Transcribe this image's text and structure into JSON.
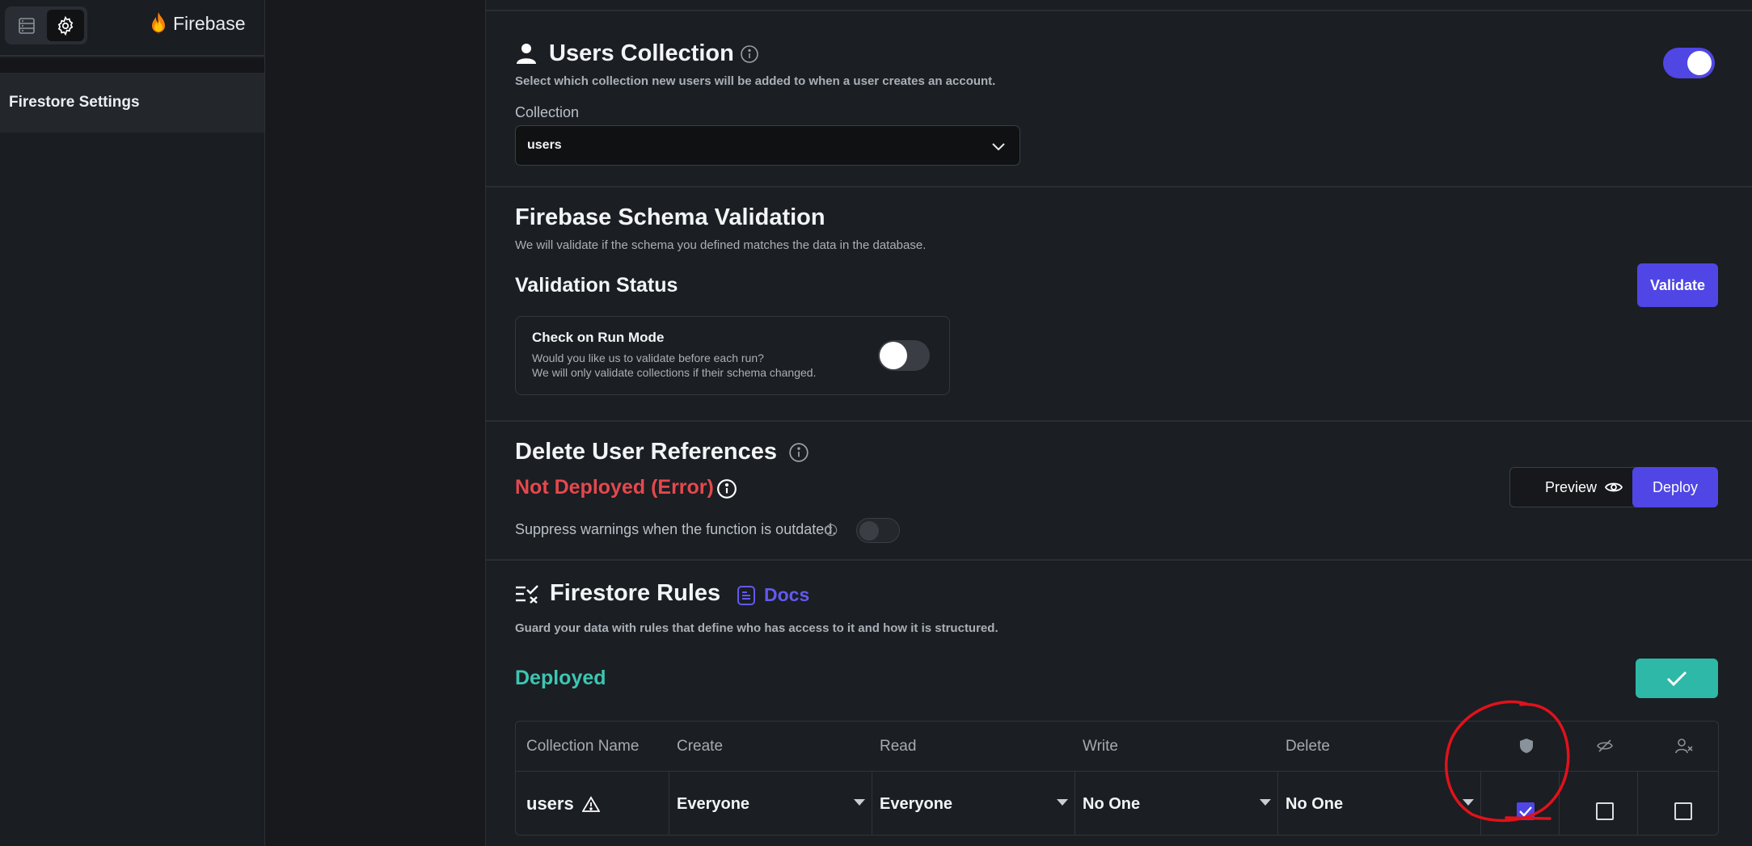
{
  "sidebar": {
    "brand": "Firebase",
    "nav_item": "Firestore Settings"
  },
  "users_collection": {
    "title": "Users Collection",
    "description": "Select which collection new users will be added to when a user creates an account.",
    "collection_label": "Collection",
    "collection_value": "users",
    "enabled": true
  },
  "schema_validation": {
    "title": "Firebase Schema Validation",
    "description": "We will validate if the schema you defined matches the data in the database.",
    "status_title": "Validation Status",
    "validate_button": "Validate",
    "check_title": "Check on Run Mode",
    "check_line1": "Would you like us to validate before each run?",
    "check_line2": "We will only validate collections if their schema changed.",
    "check_enabled": false
  },
  "delete_refs": {
    "title": "Delete User References",
    "status": "Not Deployed (Error)",
    "suppress_label": "Suppress warnings when the function is outdated.",
    "suppress_enabled": false,
    "preview_button": "Preview",
    "deploy_button": "Deploy"
  },
  "firestore_rules": {
    "title": "Firestore Rules",
    "docs_link": "Docs",
    "description": "Guard your data with rules that define who has access to it and how it is structured.",
    "status": "Deployed",
    "table": {
      "headers": [
        "Collection Name",
        "Create",
        "Read",
        "Write",
        "Delete"
      ],
      "rows": [
        {
          "name": "users",
          "create": "Everyone",
          "read": "Everyone",
          "write": "No One",
          "delete": "No One",
          "protected": true,
          "hidden": false,
          "user_removed": false
        }
      ]
    }
  },
  "colors": {
    "accent": "#4f46e5",
    "error": "#e5484d",
    "success": "#3cc6b3",
    "annotation": "#e0121b"
  }
}
